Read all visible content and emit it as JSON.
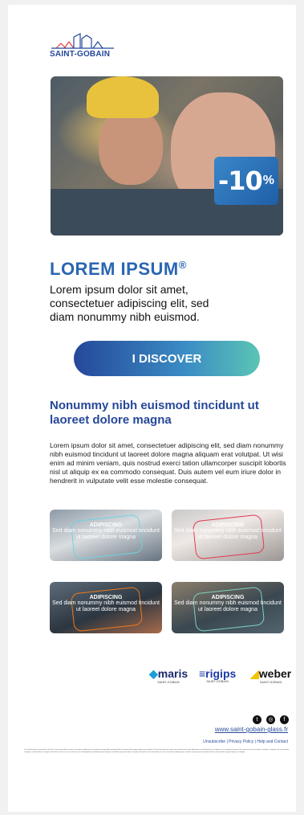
{
  "brand": {
    "name": "SAINT-GOBAIN"
  },
  "hero": {
    "discount_main": "-10",
    "discount_pct": "%"
  },
  "headline": {
    "title": "LOREM IPSUM",
    "reg": "®",
    "intro": "Lorem ipsum dolor sit amet, consectetuer adipiscing elit, sed diam nonummy nibh euismod."
  },
  "cta": {
    "label": "I DISCOVER"
  },
  "article": {
    "heading": "Nonummy nibh euismod tincidunt ut laoreet dolore magna",
    "body": "Lorem ipsum dolor sit amet, consectetuer adipiscing elit, sed diam nonummy nibh euismod tincidunt ut laoreet dolore magna aliquam erat volutpat. Ut wisi enim ad minim veniam, quis nostrud exerci tation ullamcorper suscipit lobortis nisl ut aliquip ex ea commodo consequat. Duis autem vel eum iriure dolor in hendrerit in vulputate velit esse molestie consequat."
  },
  "cards": [
    {
      "title": "ADIPISCING",
      "text": "Sed diam nonummy nibh euismod tincidunt ut laoreet dolore magna",
      "accent": "#6fd3e0"
    },
    {
      "title": "ADIPISCING",
      "text": "Sed diam nonummy nibh euismod tincidunt ut laoreet dolore magna",
      "accent": "#e03a4f"
    },
    {
      "title": "ADIPISCING",
      "text": "Sed diam nonummy nibh euismod tincidunt ut laoreet dolore magna",
      "accent": "#f07a1a"
    },
    {
      "title": "ADIPISCING",
      "text": "Sed diam nonummy nibh euismod tincidunt ut laoreet dolore magna",
      "accent": "#7fd1c0"
    }
  ],
  "brands": [
    {
      "name": "maris",
      "sub": "SAINT-GOBAIN",
      "color": "#1a2a6c"
    },
    {
      "name": "rigips",
      "sub": "SAINT-GOBAIN",
      "color": "#1c3aa5"
    },
    {
      "name": "weber",
      "sub": "SAINT-GOBAIN",
      "color": "#111111"
    }
  ],
  "footer": {
    "social": [
      "twitter-icon",
      "instagram-icon",
      "facebook-icon"
    ],
    "site": "www.saint-gobain-glass.fr",
    "links": "Unsubscribe | Privacy Policy | Help and Contact",
    "legal": "To read this email in your browser, click here. Lorem ipsum dolor sit amet, consectetuer adipiscing elit, sed diam nonummy nibh euismod tincidunt ut laoreet dolore magna aliquam erat volutpat. Ut wisi enim ad minim veniam, quis nostrud exerci tation ullamcorper suscipit lobortis nisl ut aliquip ex ea commodo consequat. Duis autem vel eum iriure dolor in hendrerit in vulputate velit esse molestie consequat, vel illum dolore eu feugiat nulla facilisis at vero eros et accumsan et iusto odio dignissim qui blandit praesent luptatum zzril delenit augue duis dolore te feugait nulla facilisi. Lorem ipsum dolor sit amet, consectetuer adipiscing elit, sed diam nonummy nibh euismod tincidunt ut laoreet dolore magna aliquam erat volutpat."
  }
}
